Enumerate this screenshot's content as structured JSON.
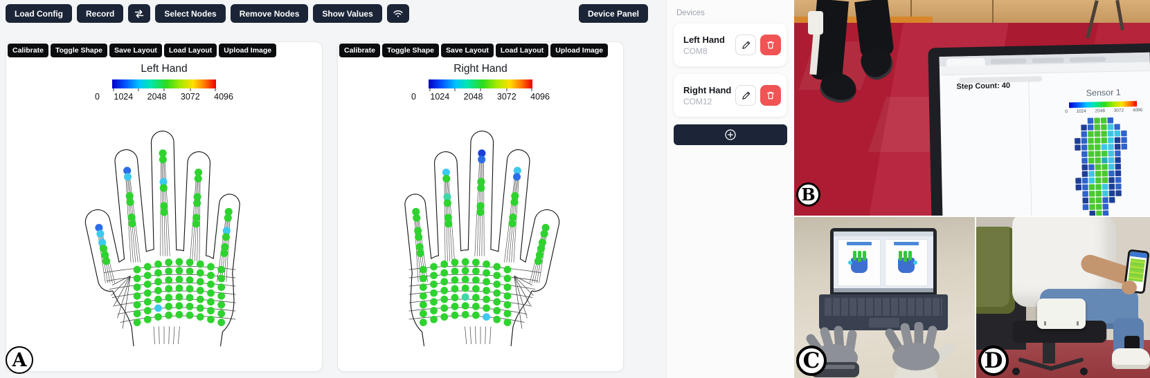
{
  "header": {
    "buttons": {
      "load_config": "Load Config",
      "record": "Record",
      "select_nodes": "Select Nodes",
      "remove_nodes": "Remove Nodes",
      "show_values": "Show Values",
      "device_panel": "Device Panel"
    }
  },
  "hand_cards": {
    "actions": [
      "Calibrate",
      "Toggle Shape",
      "Save Layout",
      "Load Layout",
      "Upload Image"
    ],
    "scale_ticks": [
      "0",
      "1024",
      "2048",
      "3072",
      "4096"
    ],
    "left": {
      "title": "Left Hand"
    },
    "right": {
      "title": "Right Hand"
    }
  },
  "devices_panel": {
    "title": "Devices",
    "devices": [
      {
        "name": "Left Hand",
        "port": "COM8"
      },
      {
        "name": "Right Hand",
        "port": "COM12"
      }
    ]
  },
  "panel_labels": {
    "a": "A",
    "b": "B",
    "c": "C",
    "d": "D"
  },
  "photo_b": {
    "step_count": "Step Count: 40",
    "sensor_title": "Sensor 1",
    "scale_ticks": [
      "0",
      "1024",
      "2048",
      "3072",
      "4096"
    ]
  },
  "colors": {
    "toolbar_button": "#1b2537",
    "card_button": "#0b0c0e",
    "danger": "#f05454",
    "scale_gradient_ends": [
      "#0000c8",
      "#ec0000"
    ]
  },
  "icons": {
    "refresh": "refresh-icon",
    "wifi": "wifi-icon",
    "edit": "pencil-icon",
    "delete": "trash-icon",
    "add": "plus-circle-icon"
  },
  "hand_viz": {
    "palette": {
      "g": "#2fd32f",
      "c": "#3cc9ee",
      "b": "#2b6de8",
      "B": "#1b40d8",
      "t": "#3fd8a8"
    },
    "hands": [
      {
        "title": "Left Hand",
        "mirror": false,
        "tip_colors": {
          "thumb": [
            "b",
            "c"
          ],
          "index": [
            "b",
            "c"
          ],
          "middle": [
            "g",
            "g"
          ],
          "ring": [
            "g",
            "g"
          ],
          "pinky": [
            "g",
            "g"
          ]
        },
        "mid_specials": [
          {
            "finger": "middle",
            "cluster": 1,
            "dot": 0,
            "color": "c"
          },
          {
            "finger": "pinky",
            "cluster": 1,
            "dot": 0,
            "color": "c"
          },
          {
            "finger": "thumb",
            "cluster": 1,
            "dot": 0,
            "color": "c"
          }
        ],
        "palm_specials": [
          {
            "row": 5,
            "i": 2,
            "color": "c"
          }
        ]
      },
      {
        "title": "Right Hand",
        "mirror": true,
        "tip_colors": {
          "thumb": [
            "g",
            "g"
          ],
          "index": [
            "c",
            "b"
          ],
          "middle": [
            "B",
            "b"
          ],
          "ring": [
            "c",
            "g"
          ],
          "pinky": [
            "g",
            "g"
          ]
        },
        "mid_specials": [
          {
            "finger": "ring",
            "cluster": 1,
            "dot": 0,
            "color": "t"
          }
        ],
        "palm_specials": [
          {
            "row": 4,
            "i": 4,
            "color": "t"
          },
          {
            "row": 6,
            "i": 2,
            "color": "c"
          }
        ]
      }
    ]
  },
  "insole": {
    "palette": {
      "n": "#1e3e96",
      "b": "#2f62cc",
      "c": "#3fc4e4",
      "g": "#49c832",
      "l": "#84dc3c",
      "t": "#2ba8b8"
    },
    "rows": [
      "..bggb..",
      ".nbggcb.",
      ".bgggccb",
      "nbgggcnb",
      "nbggccnb",
      ".bgggcb.",
      ".bggtcn.",
      ".nbggcn.",
      ".ncggbn.",
      "nbcggnb.",
      "nbggcnb.",
      ".bggcnn.",
      ".nggbn..",
      ".bggb...",
      "..ngb..."
    ]
  }
}
